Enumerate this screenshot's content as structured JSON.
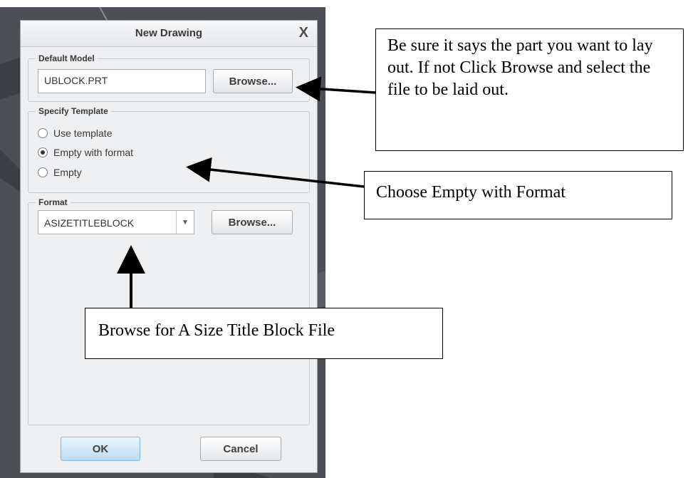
{
  "dialog": {
    "title": "New Drawing",
    "close_glyph": "X"
  },
  "default_model": {
    "legend": "Default Model",
    "value": "UBLOCK.PRT",
    "browse_label": "Browse..."
  },
  "template": {
    "legend": "Specify Template",
    "options": [
      {
        "label": "Use template",
        "checked": false
      },
      {
        "label": "Empty with format",
        "checked": true
      },
      {
        "label": "Empty",
        "checked": false
      }
    ]
  },
  "format": {
    "legend": "Format",
    "value": "ASIZETITLEBLOCK",
    "browse_label": "Browse..."
  },
  "footer": {
    "ok_label": "OK",
    "cancel_label": "Cancel"
  },
  "callouts": {
    "model_note": "Be sure it says the part you want to lay out.  If not Click Browse and select the file to be laid out.",
    "template_note": "Choose Empty with Format",
    "format_note": "Browse for A Size Title Block File"
  },
  "colors": {
    "cad_background": "#4c4f54",
    "dialog_background": "#eeeff1",
    "ok_button": "#bcdcf2"
  }
}
